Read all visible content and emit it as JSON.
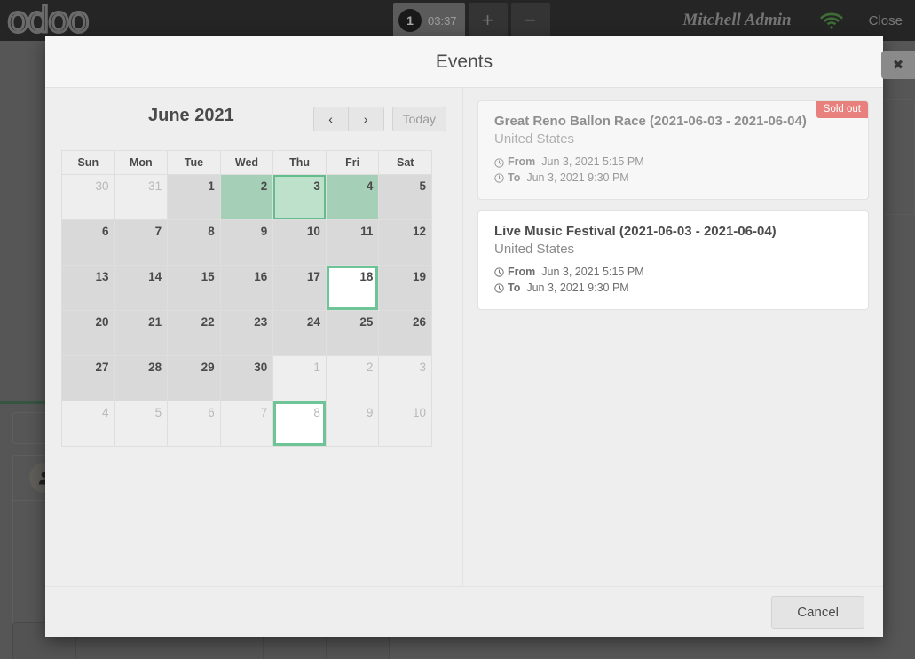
{
  "topbar": {
    "logo": "odoo",
    "order_number": "1",
    "order_time": "03:37",
    "add_order_label": "+",
    "remove_order_label": "−",
    "username": "Mitchell Admin",
    "wifi_icon": "wifi-icon",
    "close_label": "Close"
  },
  "modal": {
    "title": "Events",
    "close_icon": "✖",
    "footer": {
      "cancel_label": "Cancel"
    }
  },
  "calendar": {
    "month_label": "June 2021",
    "prev_label": "‹",
    "next_label": "›",
    "today_label": "Today",
    "weekdays": [
      "Sun",
      "Mon",
      "Tue",
      "Wed",
      "Thu",
      "Fri",
      "Sat"
    ],
    "weeks": [
      [
        {
          "n": "30",
          "state": "other"
        },
        {
          "n": "31",
          "state": "other"
        },
        {
          "n": "1",
          "state": "normal"
        },
        {
          "n": "2",
          "state": "event"
        },
        {
          "n": "3",
          "state": "selected"
        },
        {
          "n": "4",
          "state": "event"
        },
        {
          "n": "5",
          "state": "normal"
        }
      ],
      [
        {
          "n": "6",
          "state": "normal"
        },
        {
          "n": "7",
          "state": "normal"
        },
        {
          "n": "8",
          "state": "normal"
        },
        {
          "n": "9",
          "state": "normal"
        },
        {
          "n": "10",
          "state": "normal"
        },
        {
          "n": "11",
          "state": "normal"
        },
        {
          "n": "12",
          "state": "normal"
        }
      ],
      [
        {
          "n": "13",
          "state": "normal"
        },
        {
          "n": "14",
          "state": "normal"
        },
        {
          "n": "15",
          "state": "normal"
        },
        {
          "n": "16",
          "state": "normal"
        },
        {
          "n": "17",
          "state": "normal"
        },
        {
          "n": "18",
          "state": "today"
        },
        {
          "n": "19",
          "state": "normal"
        }
      ],
      [
        {
          "n": "20",
          "state": "normal"
        },
        {
          "n": "21",
          "state": "normal"
        },
        {
          "n": "22",
          "state": "normal"
        },
        {
          "n": "23",
          "state": "normal"
        },
        {
          "n": "24",
          "state": "normal"
        },
        {
          "n": "25",
          "state": "normal"
        },
        {
          "n": "26",
          "state": "normal"
        }
      ],
      [
        {
          "n": "27",
          "state": "normal"
        },
        {
          "n": "28",
          "state": "normal"
        },
        {
          "n": "29",
          "state": "normal"
        },
        {
          "n": "30",
          "state": "normal"
        },
        {
          "n": "1",
          "state": "other"
        },
        {
          "n": "2",
          "state": "other"
        },
        {
          "n": "3",
          "state": "other"
        }
      ],
      [
        {
          "n": "4",
          "state": "other"
        },
        {
          "n": "5",
          "state": "other"
        },
        {
          "n": "6",
          "state": "other"
        },
        {
          "n": "7",
          "state": "other"
        },
        {
          "n": "8",
          "state": "other-today"
        },
        {
          "n": "9",
          "state": "other"
        },
        {
          "n": "10",
          "state": "other"
        }
      ]
    ]
  },
  "events": {
    "from_label": "From",
    "to_label": "To",
    "items": [
      {
        "name": "Great Reno Ballon Race (2021-06-03 - 2021-06-04)",
        "location": "United States",
        "from": "Jun 3, 2021 5:15 PM",
        "to": "Jun 3, 2021 9:30 PM",
        "badge": "Sold out",
        "sold_out": true
      },
      {
        "name": "Live Music Festival (2021-06-03 - 2021-06-04)",
        "location": "United States",
        "from": "Jun 3, 2021 5:15 PM",
        "to": "Jun 3, 2021 9:30 PM",
        "badge": "",
        "sold_out": false
      }
    ]
  },
  "colors": {
    "event_green": "#a6cfb7",
    "selected_green": "#bde1cb",
    "today_border": "#6ec497",
    "sold_out_red": "#e8817e",
    "modal_bg": "#efeeee"
  }
}
